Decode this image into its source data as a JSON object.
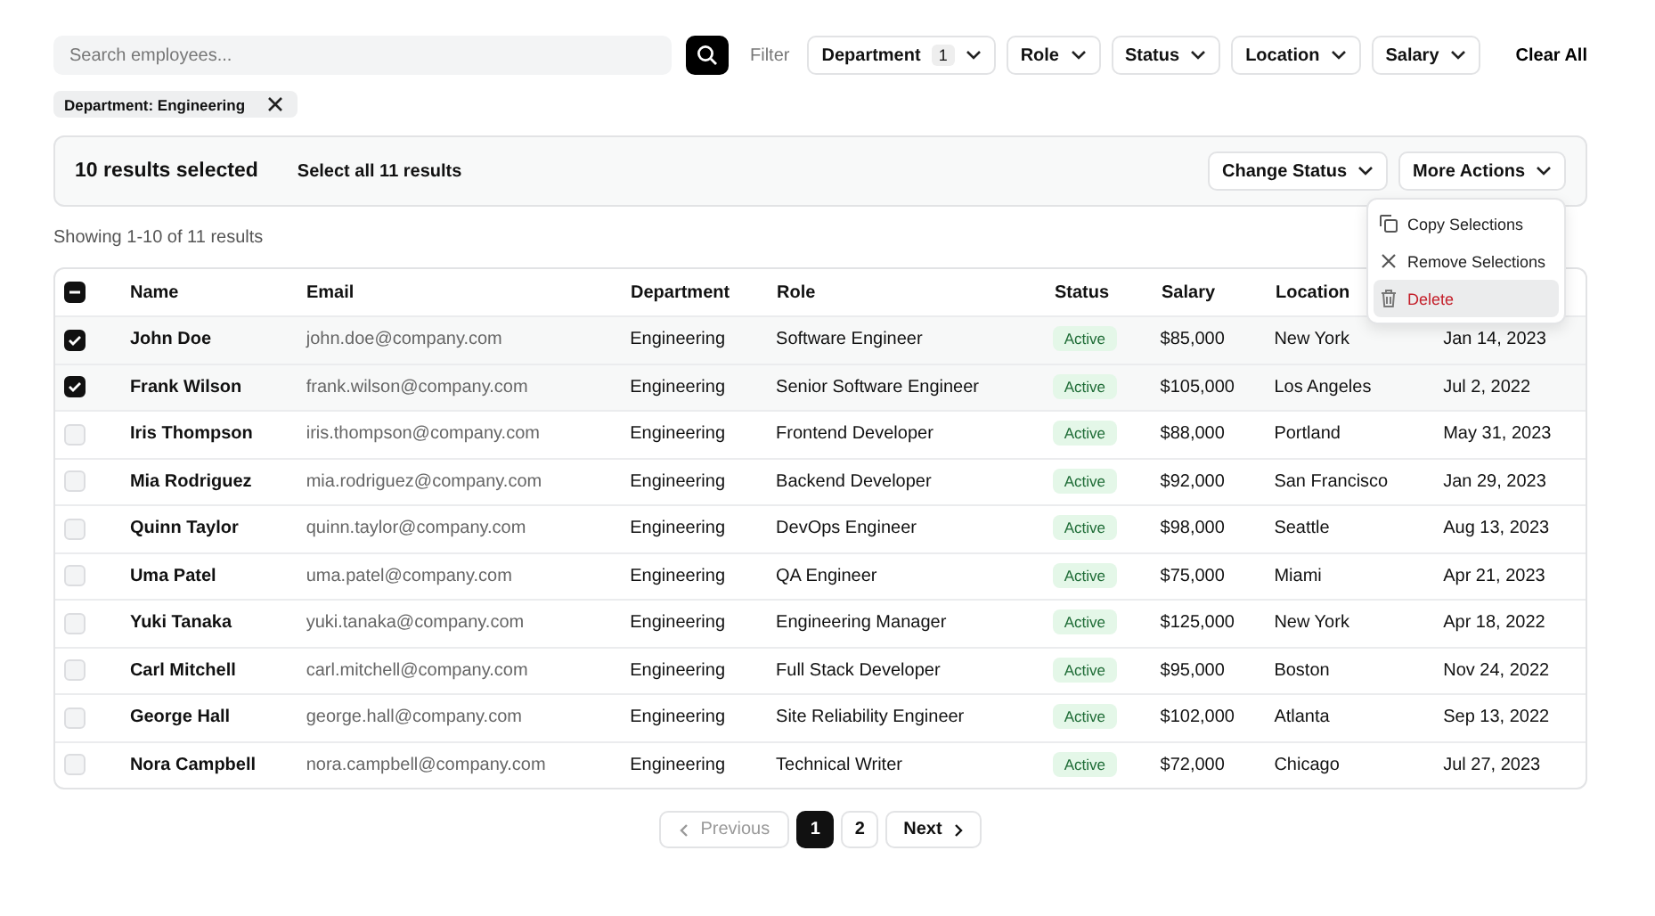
{
  "search": {
    "placeholder": "Search employees..."
  },
  "filter_label": "Filter",
  "filters": [
    {
      "label": "Department",
      "count": "1"
    },
    {
      "label": "Role"
    },
    {
      "label": "Status"
    },
    {
      "label": "Location"
    },
    {
      "label": "Salary"
    }
  ],
  "clear_all": "Clear All",
  "active_filters": [
    {
      "label": "Department: Engineering"
    }
  ],
  "selection_bar": {
    "count_text": "10 results selected",
    "select_all": "Select all 11 results",
    "buttons": [
      "Change Status",
      "More Actions"
    ]
  },
  "menu": {
    "items": [
      {
        "kind": "copy",
        "label": "Copy Selections",
        "highlighted": false,
        "danger": false
      },
      {
        "kind": "remove",
        "label": "Remove Selections",
        "highlighted": false,
        "danger": false
      },
      {
        "kind": "delete",
        "label": "Delete",
        "highlighted": true,
        "danger": true
      }
    ]
  },
  "results_text": "Showing 1-10 of 11 results",
  "table": {
    "header_checkbox": {
      "indeterminate": true
    },
    "columns": [
      "Name",
      "Email",
      "Department",
      "Role",
      "Status",
      "Salary",
      "Location"
    ],
    "rows": [
      {
        "selected": true,
        "name": "John Doe",
        "email": "john.doe@company.com",
        "department": "Engineering",
        "role": "Software Engineer",
        "status": "Active",
        "salary": "$85,000",
        "location": "New York",
        "column_9": "Jan 14, 2023"
      },
      {
        "selected": true,
        "name": "Frank Wilson",
        "email": "frank.wilson@company.com",
        "department": "Engineering",
        "role": "Senior Software Engineer",
        "status": "Active",
        "salary": "$105,000",
        "location": "Los Angeles",
        "column_9": "Jul 2, 2022"
      },
      {
        "selected": false,
        "name": "Iris Thompson",
        "email": "iris.thompson@company.com",
        "department": "Engineering",
        "role": "Frontend Developer",
        "status": "Active",
        "salary": "$88,000",
        "location": "Portland",
        "column_9": "May 31, 2023"
      },
      {
        "selected": false,
        "name": "Mia Rodriguez",
        "email": "mia.rodriguez@company.com",
        "department": "Engineering",
        "role": "Backend Developer",
        "status": "Active",
        "salary": "$92,000",
        "location": "San Francisco",
        "column_9": "Jan 29, 2023"
      },
      {
        "selected": false,
        "name": "Quinn Taylor",
        "email": "quinn.taylor@company.com",
        "department": "Engineering",
        "role": "DevOps Engineer",
        "status": "Active",
        "salary": "$98,000",
        "location": "Seattle",
        "column_9": "Aug 13, 2023"
      },
      {
        "selected": false,
        "name": "Uma Patel",
        "email": "uma.patel@company.com",
        "department": "Engineering",
        "role": "QA Engineer",
        "status": "Active",
        "salary": "$75,000",
        "location": "Miami",
        "column_9": "Apr 21, 2023"
      },
      {
        "selected": false,
        "name": "Yuki Tanaka",
        "email": "yuki.tanaka@company.com",
        "department": "Engineering",
        "role": "Engineering Manager",
        "status": "Active",
        "salary": "$125,000",
        "location": "New York",
        "column_9": "Apr 18, 2022"
      },
      {
        "selected": false,
        "name": "Carl Mitchell",
        "email": "carl.mitchell@company.com",
        "department": "Engineering",
        "role": "Full Stack Developer",
        "status": "Active",
        "salary": "$95,000",
        "location": "Boston",
        "column_9": "Nov 24, 2022"
      },
      {
        "selected": false,
        "name": "George Hall",
        "email": "george.hall@company.com",
        "department": "Engineering",
        "role": "Site Reliability Engineer",
        "status": "Active",
        "salary": "$102,000",
        "location": "Atlanta",
        "column_9": "Sep 13, 2022"
      },
      {
        "selected": false,
        "name": "Nora Campbell",
        "email": "nora.campbell@company.com",
        "department": "Engineering",
        "role": "Technical Writer",
        "status": "Active",
        "salary": "$72,000",
        "location": "Chicago",
        "column_9": "Jul 27, 2023"
      }
    ]
  },
  "pagination": {
    "previous": {
      "label": "Previous",
      "disabled": true
    },
    "pages": [
      {
        "label": "1",
        "selected": true
      },
      {
        "label": "2",
        "selected": false
      }
    ],
    "next": {
      "label": "Next",
      "disabled": false
    }
  }
}
